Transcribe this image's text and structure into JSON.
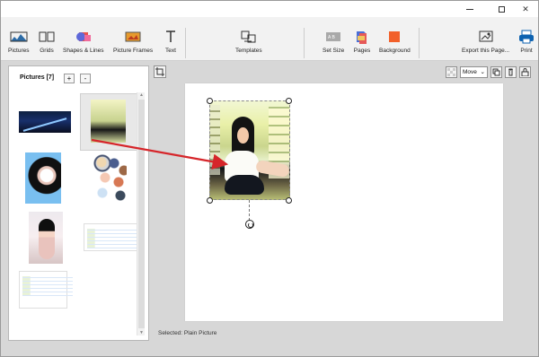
{
  "window": {
    "title": "",
    "controls": {
      "minimize": "—",
      "maximize": "□",
      "close": "✕"
    }
  },
  "toolbar": {
    "items": [
      {
        "label": "Pictures",
        "icon": "pictures-icon"
      },
      {
        "label": "Grids",
        "icon": "grids-icon"
      },
      {
        "label": "Shapes & Lines",
        "icon": "shapes-lines-icon"
      },
      {
        "label": "Picture Frames",
        "icon": "picture-frames-icon"
      },
      {
        "label": "Text",
        "icon": "text-icon"
      },
      {
        "label": "Templates",
        "icon": "templates-icon"
      },
      {
        "label": "Set Size",
        "icon": "set-size-icon"
      },
      {
        "label": "Pages",
        "icon": "pages-icon"
      },
      {
        "label": "Background",
        "icon": "background-icon"
      },
      {
        "label": "Export this Page...",
        "icon": "export-icon"
      },
      {
        "label": "Print",
        "icon": "print-icon"
      }
    ]
  },
  "left_panel": {
    "title": "Pictures [7]",
    "add_label": "+",
    "remove_label": "-",
    "thumbnails": [
      {
        "name": "night-thumbnail",
        "selected": false
      },
      {
        "name": "library-girl-thumbnail",
        "selected": true
      },
      {
        "name": "blue-girl-thumbnail",
        "selected": false
      },
      {
        "name": "circle-collage-thumbnail",
        "selected": false
      },
      {
        "name": "pink-girl-thumbnail",
        "selected": false
      },
      {
        "name": "window-screenshot-thumbnail",
        "selected": false
      },
      {
        "name": "document-screenshot-thumbnail",
        "selected": false
      }
    ]
  },
  "canvas": {
    "move_mode": "Move",
    "status": "Selected: Plain Picture"
  },
  "colors": {
    "accent": "#0d62b0",
    "arrow": "#d6252a",
    "page": "#ffffff",
    "workspace": "#d7d7d7"
  }
}
